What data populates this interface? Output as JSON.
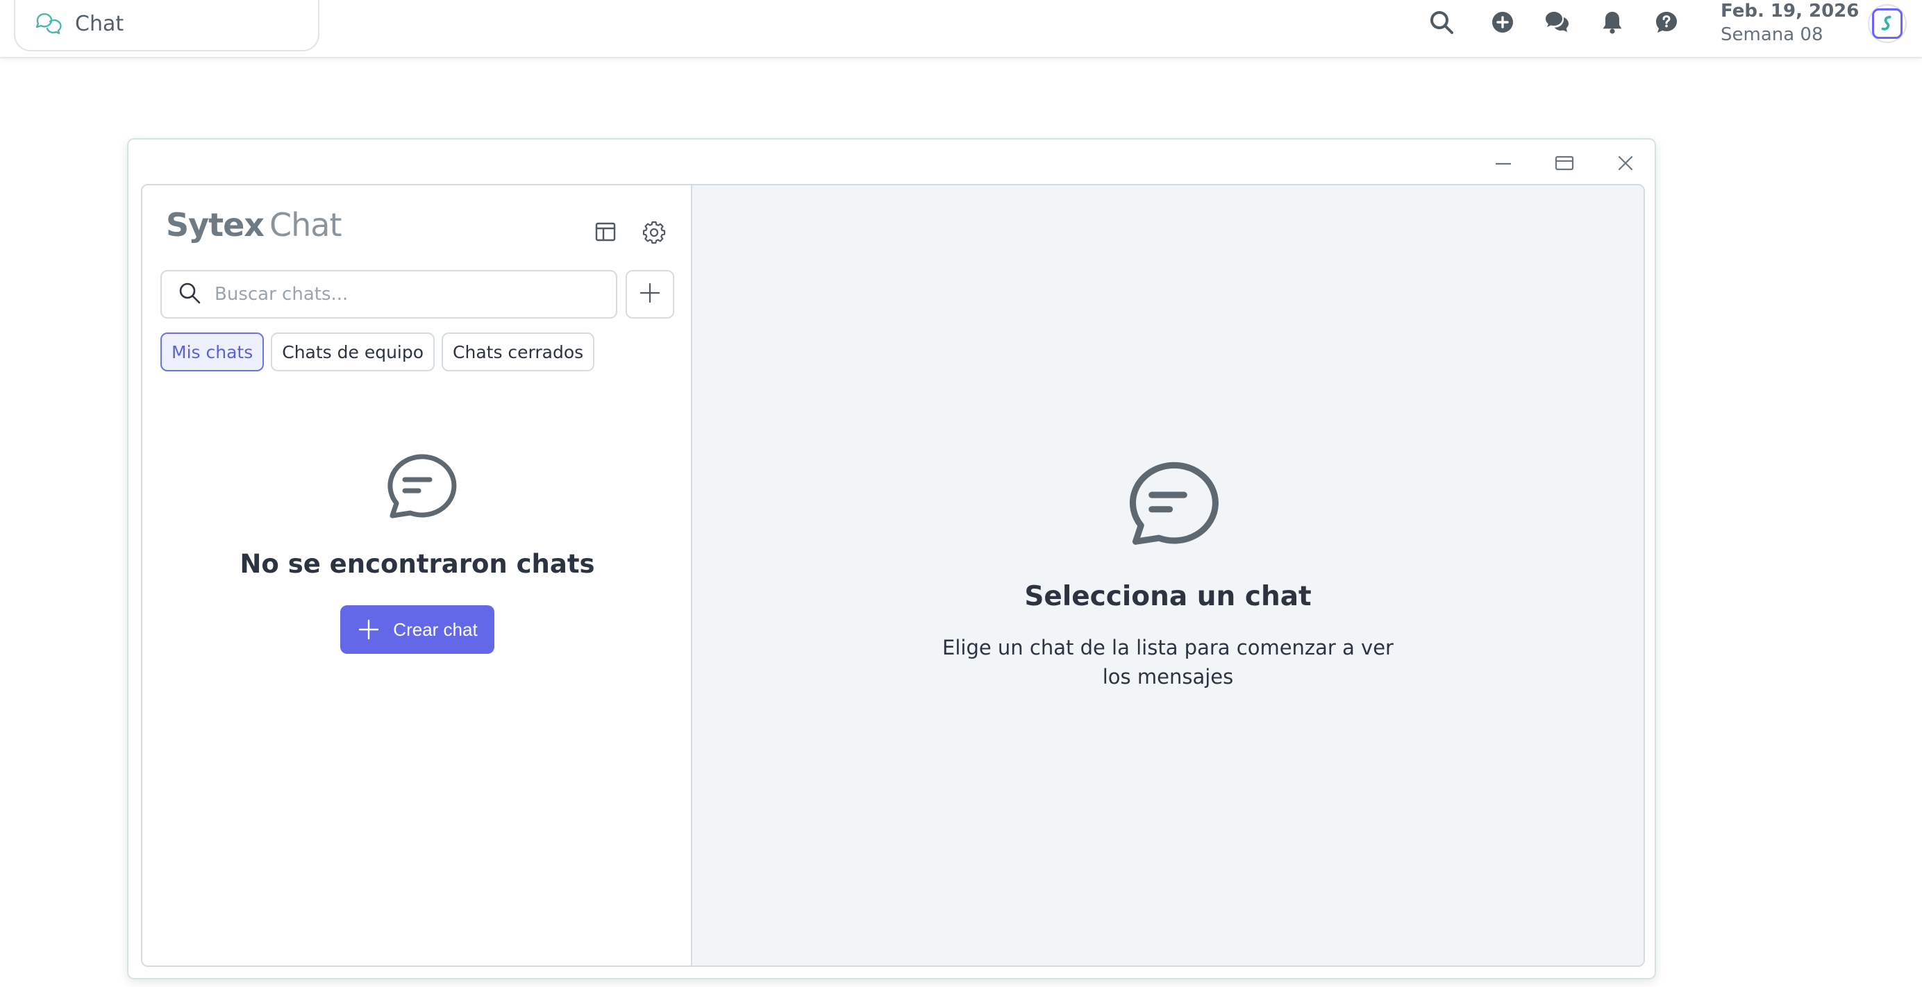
{
  "topbar": {
    "module_label": "Chat",
    "module_icon": "chat-bubbles-icon",
    "icons": [
      "search-icon",
      "plus-circle-icon",
      "chat-bubbles-icon",
      "bell-icon",
      "help-icon"
    ],
    "date": "Feb. 19, 2026",
    "week": "Semana 08"
  },
  "window": {
    "controls": [
      "minimize-icon",
      "maximize-icon",
      "close-icon"
    ]
  },
  "sidebar": {
    "brand_primary": "Sytex",
    "brand_secondary": "Chat",
    "search_placeholder": "Buscar chats...",
    "tabs": [
      {
        "label": "Mis chats",
        "active": true
      },
      {
        "label": "Chats de equipo",
        "active": false
      },
      {
        "label": "Chats cerrados",
        "active": false
      }
    ],
    "empty_title": "No se encontraron chats",
    "create_label": "Crear chat"
  },
  "main": {
    "empty_title": "Selecciona un chat",
    "empty_desc": "Elige un chat de la lista para comenzar a ver los mensajes"
  },
  "colors": {
    "accent": "#6268e8",
    "active_tab_bg": "#eef0ff",
    "pane_bg": "#f1f5f8",
    "teal_icon": "#4fb6a8"
  }
}
